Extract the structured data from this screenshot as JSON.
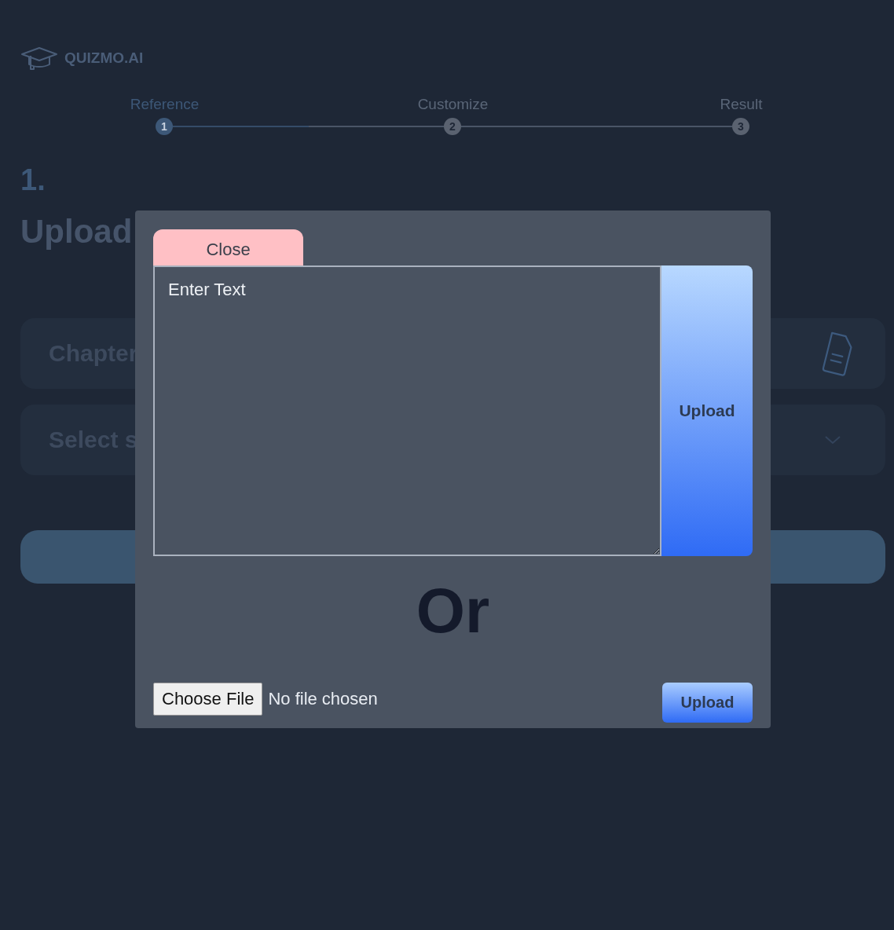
{
  "brand": {
    "name": "QUIZMO.AI"
  },
  "stepper": {
    "connectors": [
      {
        "level": 0.5
      },
      {
        "level": 0
      }
    ],
    "steps": [
      {
        "label": "Reference",
        "number": "1",
        "selected": true
      },
      {
        "label": "Customize",
        "number": "2",
        "selected": false
      },
      {
        "label": "Result",
        "number": "3",
        "selected": false
      }
    ]
  },
  "section": {
    "number": "1.",
    "title": "Upload"
  },
  "fields": [
    {
      "kind": "file",
      "placeholder": "Chapter"
    },
    {
      "kind": "select",
      "placeholder": "Select s"
    }
  ],
  "modal": {
    "close_tab": "Close",
    "text_area": {
      "placeholder": "Enter Text"
    },
    "text_upload_button": "Upload",
    "divider": "Or",
    "file_picker": {
      "button": "Choose File",
      "status": "No file chosen"
    },
    "file_upload_button": "Upload"
  }
}
